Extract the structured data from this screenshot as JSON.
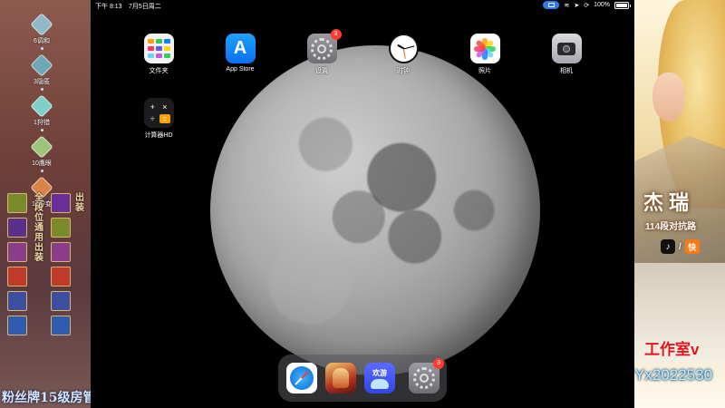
{
  "status_bar": {
    "time": "下午 8:13",
    "date": "7月5日周二",
    "battery": "100%",
    "battery_level": 1.0,
    "icons": [
      "screen-mirroring-icon",
      "wifi-icon",
      "location-icon",
      "orientation-lock-icon",
      "battery-icon"
    ]
  },
  "wallpaper": "full-moon",
  "home_apps": [
    {
      "name": "文件夹",
      "icon": "files-folder-icon"
    },
    {
      "name": "App Store",
      "icon": "app-store-icon"
    },
    {
      "name": "设置",
      "icon": "settings-gear-icon",
      "badge": "3"
    },
    {
      "name": "时钟",
      "icon": "clock-icon"
    },
    {
      "name": "照片",
      "icon": "photos-icon"
    },
    {
      "name": "相机",
      "icon": "camera-icon"
    },
    {
      "name": "计算器HD",
      "icon": "calculator-icon"
    }
  ],
  "calculator_keys": [
    "+",
    "×",
    "÷",
    "="
  ],
  "dock": {
    "apps": [
      {
        "icon": "safari-icon"
      },
      {
        "icon": "honor-of-kings-game-icon"
      },
      {
        "icon": "huanyou-app-icon",
        "label": "欢游"
      },
      {
        "icon": "settings-gear-icon",
        "badge": "3"
      }
    ]
  },
  "left_overlay": {
    "ranks": [
      {
        "label": "6调和",
        "color": "#8fb8c9"
      },
      {
        "label": "3隐匿",
        "color": "#6fa7b8"
      },
      {
        "label": "1狩猎",
        "color": "#7fd0c9"
      },
      {
        "label": "10鹰眼",
        "color": "#9cc47a"
      },
      {
        "label": "10异变",
        "color": "#d9824a"
      }
    ],
    "equip_title": "全段位通用出装",
    "equip_title_right": "出装",
    "equip_colors": [
      "#7a8a2a",
      "#5b2f8c",
      "#8a3d8a",
      "#c03a2b",
      "#3c4fa0",
      "#2f5bb0"
    ],
    "equip_colors_right": [
      "#6a2f9a",
      "#7a8a2a",
      "#8a3d8a",
      "#c03a2b",
      "#3c4fa0",
      "#2f5bb0"
    ],
    "fan_label": "粉丝牌15级房管"
  },
  "right_overlay": {
    "hero_name": "杰瑞",
    "hero_subtitle": "114段对抗路",
    "social_tiktok": "♪",
    "social_sep": "/",
    "social_kuaishou": "快",
    "studio": "工作室v",
    "contact": "Yx2022530"
  }
}
